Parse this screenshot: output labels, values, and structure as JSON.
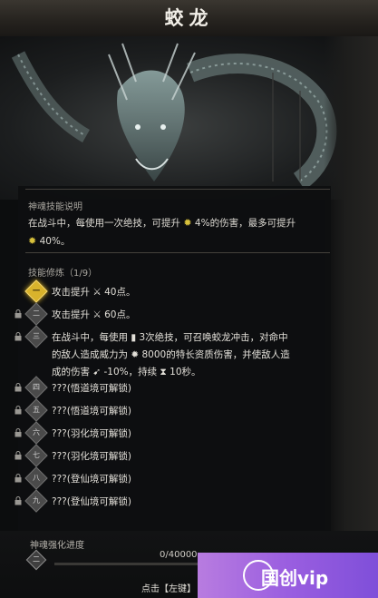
{
  "title": "蛟龙",
  "colors": {
    "accent_gold": "#d9b32c",
    "icon_yellow": "#d9c23c",
    "watermark_purple": "#9a5ee0"
  },
  "skill_description": {
    "heading": "神魂技能说明",
    "line1_pre": "在战斗中，每使用一次绝技，可提升",
    "line1_val": "4%的伤害，最多可提升",
    "line2_val": "40%。"
  },
  "refine": {
    "heading": "技能修炼（1/9）",
    "rows": [
      {
        "num": "一",
        "locked": false,
        "active": true,
        "text": "攻击提升 ⚔ 40点。"
      },
      {
        "num": "二",
        "locked": true,
        "active": false,
        "text": "攻击提升 ⚔ 60点。"
      },
      {
        "num": "三",
        "locked": true,
        "active": false,
        "line1": "在战斗中，每使用 ▮ 3次绝技，可召唤蛟龙冲击，对命中",
        "line2": "的敌人造成威力为 ✹ 8000的特长资质伤害，并使敌人造",
        "line3": "成的伤害 ➹ -10%，持续 ⧗ 10秒。"
      },
      {
        "num": "四",
        "locked": true,
        "active": false,
        "text": "???(悟道境可解锁)"
      },
      {
        "num": "五",
        "locked": true,
        "active": false,
        "text": "???(悟道境可解锁)"
      },
      {
        "num": "六",
        "locked": true,
        "active": false,
        "text": "???(羽化境可解锁)"
      },
      {
        "num": "七",
        "locked": true,
        "active": false,
        "text": "???(羽化境可解锁)"
      },
      {
        "num": "八",
        "locked": true,
        "active": false,
        "text": "???(登仙境可解锁)"
      },
      {
        "num": "九",
        "locked": true,
        "active": false,
        "text": "???(登仙境可解锁)"
      }
    ]
  },
  "progress": {
    "label": "神魂强化进度",
    "value_text": "0/40000",
    "fraction": 0,
    "level_num": "二"
  },
  "hint": "点击【左键】",
  "watermark": {
    "text": "国创vip"
  },
  "icons": [
    "lock-icon",
    "sun-icon",
    "sword-icon",
    "scroll-icon",
    "hourglass-icon",
    "arrow-down-icon"
  ]
}
